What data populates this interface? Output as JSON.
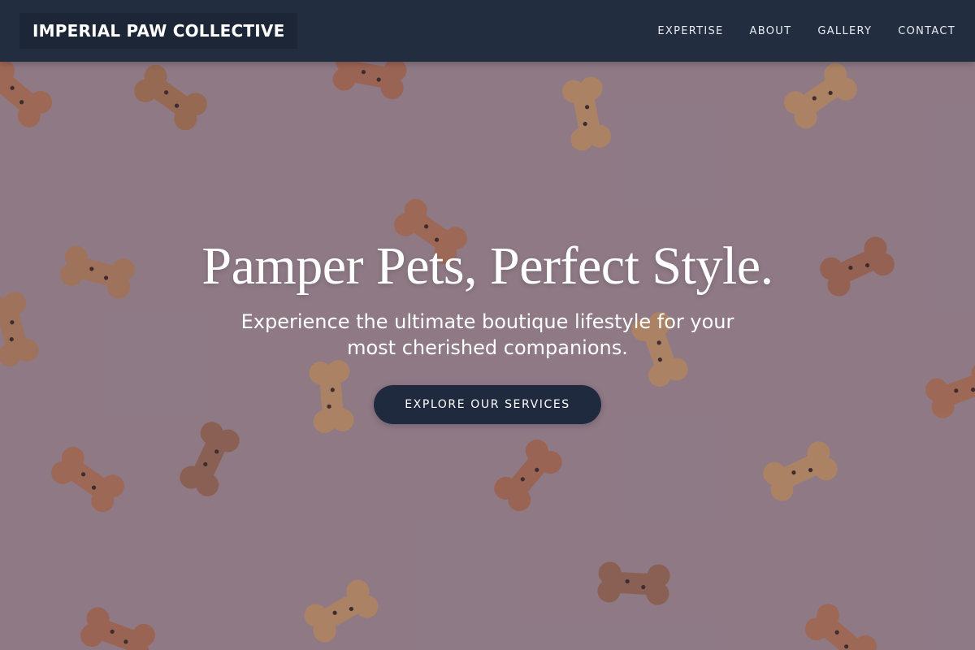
{
  "header": {
    "brand": "IMPERIAL PAW COLLECTIVE",
    "nav": [
      {
        "label": "EXPERTISE"
      },
      {
        "label": "ABOUT"
      },
      {
        "label": "GALLERY"
      },
      {
        "label": "CONTACT"
      }
    ]
  },
  "hero": {
    "title": "Pamper Pets, Perfect Style.",
    "subtitle": "Experience the ultimate boutique lifestyle for your most cherished companions.",
    "cta_label": "EXPLORE OUR SERVICES",
    "background_image": "dog-bone-biscuits-on-pink"
  },
  "colors": {
    "header_bg": "#222d40",
    "brand_bg": "#1c2636",
    "cta_bg": "#1f2a3e",
    "hero_bg": "#9b8590",
    "text_light": "#ffffff"
  }
}
